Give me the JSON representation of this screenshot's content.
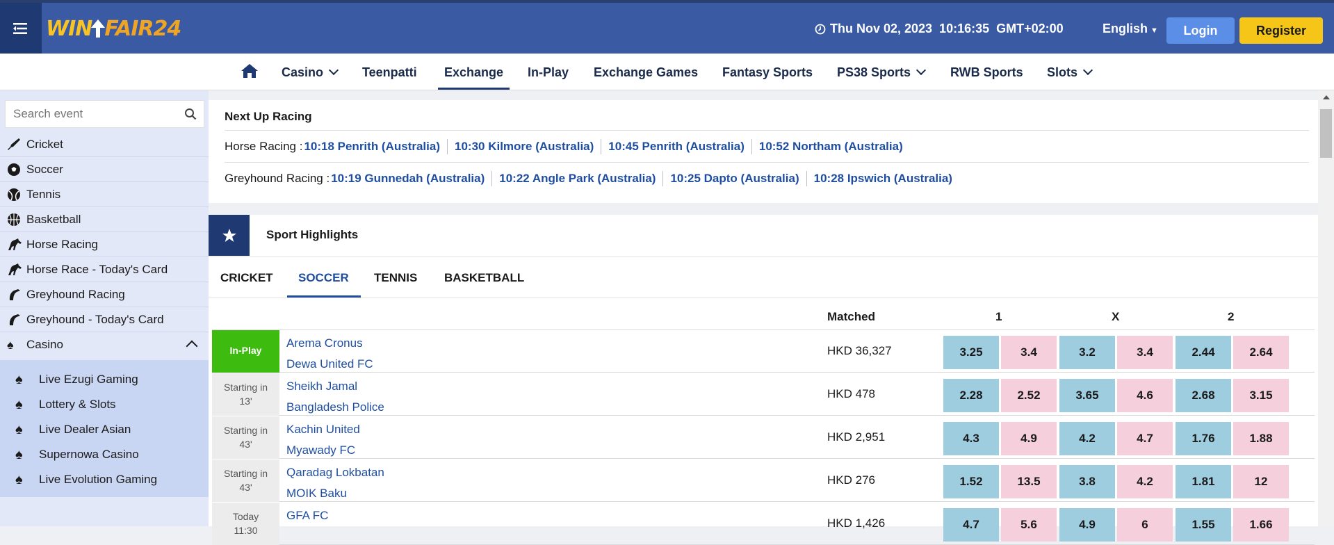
{
  "header": {
    "logo_part1": "WIN",
    "logo_part2": "FAIR24",
    "datetime": "Thu Nov 02, 2023  10:16:35  GMT+02:00",
    "language": "English",
    "login_label": "Login",
    "register_label": "Register"
  },
  "nav": {
    "items": [
      "Casino",
      "Teenpatti",
      "Exchange",
      "In-Play",
      "Exchange Games",
      "Fantasy Sports",
      "PS38 Sports",
      "RWB Sports",
      "Slots"
    ],
    "active": "Exchange"
  },
  "sidebar": {
    "search_placeholder": "Search event",
    "items": [
      "Cricket",
      "Soccer",
      "Tennis",
      "Basketball",
      "Horse Racing",
      "Horse Race - Today's Card",
      "Greyhound Racing",
      "Greyhound - Today's Card",
      "Casino"
    ],
    "casino_sub": [
      "Live Ezugi Gaming",
      "Lottery & Slots",
      "Live Dealer Asian",
      "Supernowa Casino",
      "Live Evolution Gaming"
    ]
  },
  "racing": {
    "title": "Next Up Racing",
    "horse_label": "Horse Racing :",
    "horse_events": [
      "10:18 Penrith (Australia)",
      "10:30 Kilmore (Australia)",
      "10:45 Penrith (Australia)",
      "10:52 Northam (Australia)"
    ],
    "greyhound_label": "Greyhound Racing :",
    "greyhound_events": [
      "10:19 Gunnedah (Australia)",
      "10:22 Angle Park (Australia)",
      "10:25 Dapto (Australia)",
      "10:28 Ipswich (Australia)"
    ]
  },
  "highlights": {
    "title": "Sport Highlights",
    "tabs": [
      "CRICKET",
      "SOCCER",
      "TENNIS",
      "BASKETBALL"
    ],
    "active_tab": "SOCCER",
    "columns": {
      "matched": "Matched",
      "c1": "1",
      "cx": "X",
      "c2": "2"
    },
    "rows": [
      {
        "status_line1": "In-Play",
        "status_line2": "",
        "team1": "Arema Cronus",
        "team2": "Dewa United FC",
        "matched": "HKD 36,327",
        "odds": [
          "3.25",
          "3.4",
          "3.2",
          "3.4",
          "2.44",
          "2.64"
        ]
      },
      {
        "status_line1": "Starting in",
        "status_line2": "13'",
        "team1": "Sheikh Jamal",
        "team2": "Bangladesh Police",
        "matched": "HKD 478",
        "odds": [
          "2.28",
          "2.52",
          "3.65",
          "4.6",
          "2.68",
          "3.15"
        ]
      },
      {
        "status_line1": "Starting in",
        "status_line2": "43'",
        "team1": "Kachin United",
        "team2": "Myawady FC",
        "matched": "HKD 2,951",
        "odds": [
          "4.3",
          "4.9",
          "4.2",
          "4.7",
          "1.76",
          "1.88"
        ]
      },
      {
        "status_line1": "Starting in",
        "status_line2": "43'",
        "team1": "Qaradag Lokbatan",
        "team2": "MOIK Baku",
        "matched": "HKD 276",
        "odds": [
          "1.52",
          "13.5",
          "3.8",
          "4.2",
          "1.81",
          "12"
        ]
      },
      {
        "status_line1": "Today",
        "status_line2": "11:30",
        "team1": "GFA FC",
        "team2": "",
        "matched": "HKD 1,426",
        "odds": [
          "4.7",
          "5.6",
          "4.9",
          "6",
          "1.55",
          "1.66"
        ]
      }
    ]
  },
  "colors": {
    "header_bg": "#3a5ba3",
    "accent_dark": "#1f3a72",
    "link_blue": "#1f4ea1",
    "back_odds": "#9fcde0",
    "lay_odds": "#f6cfdd",
    "inplay_green": "#3dbb0f",
    "register_yellow": "#f5c518",
    "login_blue": "#5b8ee6"
  }
}
